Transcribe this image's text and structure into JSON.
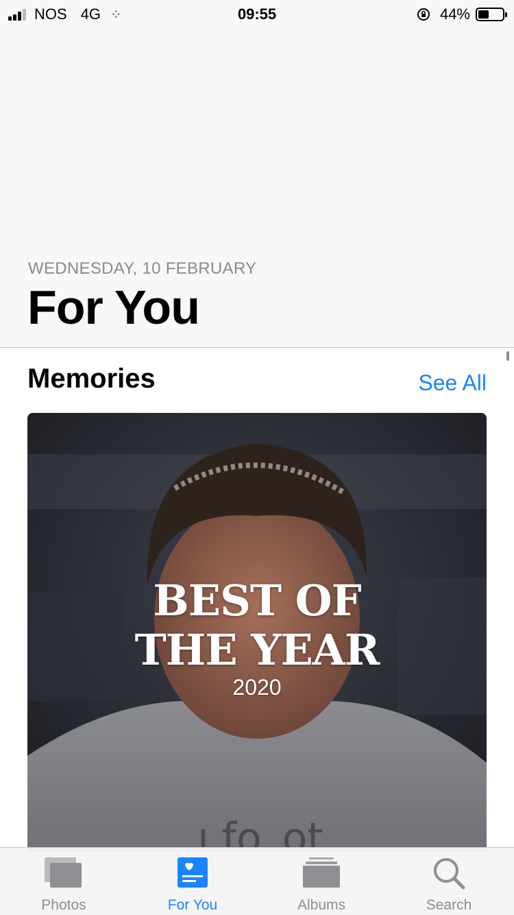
{
  "status_bar": {
    "carrier": "NOS",
    "network": "4G",
    "time": "09:55",
    "battery_percent": "44%",
    "battery_level": 0.44
  },
  "header": {
    "date": "WEDNESDAY, 10 FEBRUARY",
    "title": "For You"
  },
  "memories": {
    "section_title": "Memories",
    "see_all_label": "See All",
    "card": {
      "title_line1": "BEST OF",
      "title_line2": "THE YEAR",
      "year": "2020"
    }
  },
  "tab_bar": {
    "tabs": [
      {
        "label": "Photos",
        "icon": "photos-icon",
        "active": false
      },
      {
        "label": "For You",
        "icon": "for-you-icon",
        "active": true
      },
      {
        "label": "Albums",
        "icon": "albums-icon",
        "active": false
      },
      {
        "label": "Search",
        "icon": "search-icon",
        "active": false
      }
    ]
  },
  "colors": {
    "accent": "#1a84ff",
    "inactive": "#8e8e93"
  }
}
